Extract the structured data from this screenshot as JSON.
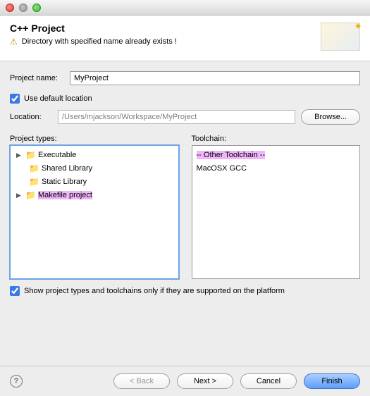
{
  "header": {
    "title": "C++ Project",
    "warning": "Directory with specified name already exists !"
  },
  "form": {
    "project_name_label": "Project name:",
    "project_name_value": "MyProject",
    "use_default_location_label": "Use default location",
    "location_label": "Location:",
    "location_value": "/Users/mjackson/Workspace/MyProject",
    "browse_label": "Browse...",
    "project_types_label": "Project types:",
    "toolchain_label": "Toolchain:",
    "show_supported_label": "Show project types and toolchains only if they are supported on the platform"
  },
  "project_types": [
    {
      "label": "Executable",
      "expandable": true
    },
    {
      "label": "Shared Library",
      "expandable": false
    },
    {
      "label": "Static Library",
      "expandable": false
    },
    {
      "label": "Makefile project",
      "expandable": true,
      "highlight": true
    }
  ],
  "toolchains": [
    {
      "label": "-- Other Toolchain --",
      "highlight": true
    },
    {
      "label": "MacOSX GCC",
      "highlight": false
    }
  ],
  "buttons": {
    "back": "< Back",
    "next": "Next >",
    "cancel": "Cancel",
    "finish": "Finish"
  }
}
